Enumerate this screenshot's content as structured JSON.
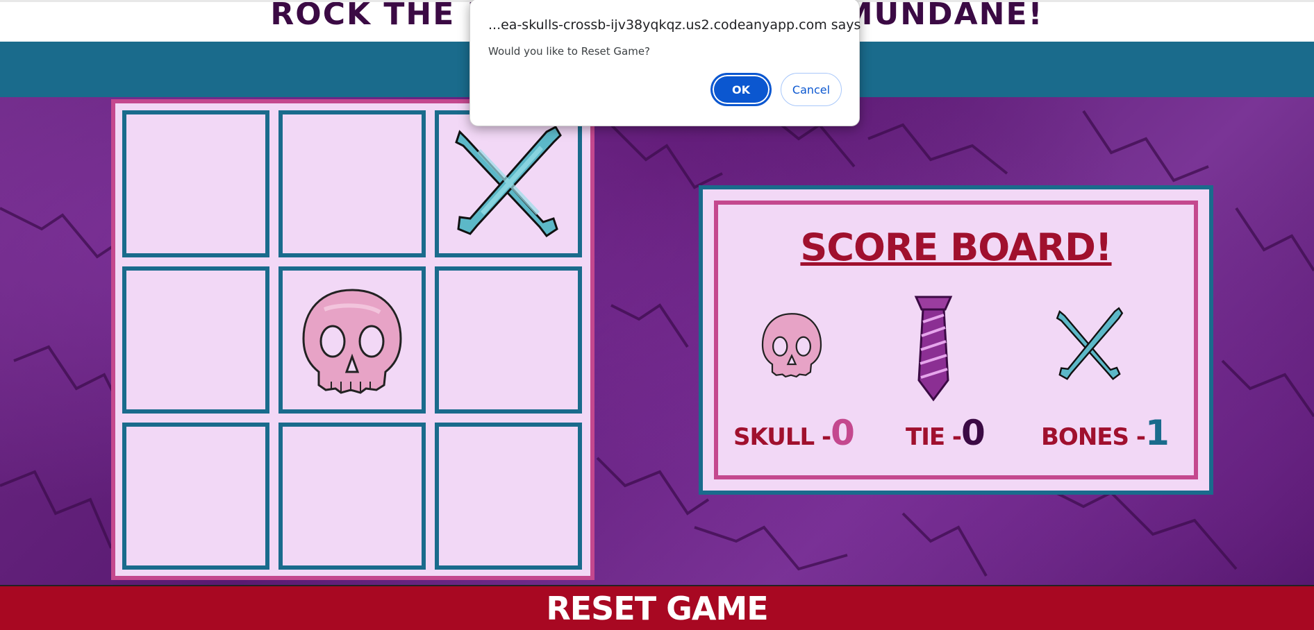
{
  "header": {
    "title": "ROCK THE BOARD, SHOCK THE MUNDANE!"
  },
  "board": {
    "cells": [
      "",
      "",
      "bones",
      "",
      "skull",
      "",
      "",
      "",
      ""
    ]
  },
  "scoreboard": {
    "title": "SCORE  BOARD!",
    "items": [
      {
        "label": "SKULL -",
        "value": "0",
        "icon": "skull-icon",
        "color": "#c4488e"
      },
      {
        "label": "TIE -",
        "value": "0",
        "icon": "tie-icon",
        "color": "#3b0a44"
      },
      {
        "label": "BONES -",
        "value": "1",
        "icon": "crossbones-icon",
        "color": "#1a6b8c"
      }
    ]
  },
  "reset": {
    "label": "RESET GAME"
  },
  "dialog": {
    "origin": "...ea-skulls-crossb-ijv38yqkqz.us2.codeanyapp.com says",
    "message": "Would you like to Reset Game?",
    "ok_label": "OK",
    "cancel_label": "Cancel"
  },
  "colors": {
    "accent_blue": "#1a6b8c",
    "accent_pink": "#c4488e",
    "accent_red": "#a80822",
    "cell_bg": "#f2d8f6"
  }
}
